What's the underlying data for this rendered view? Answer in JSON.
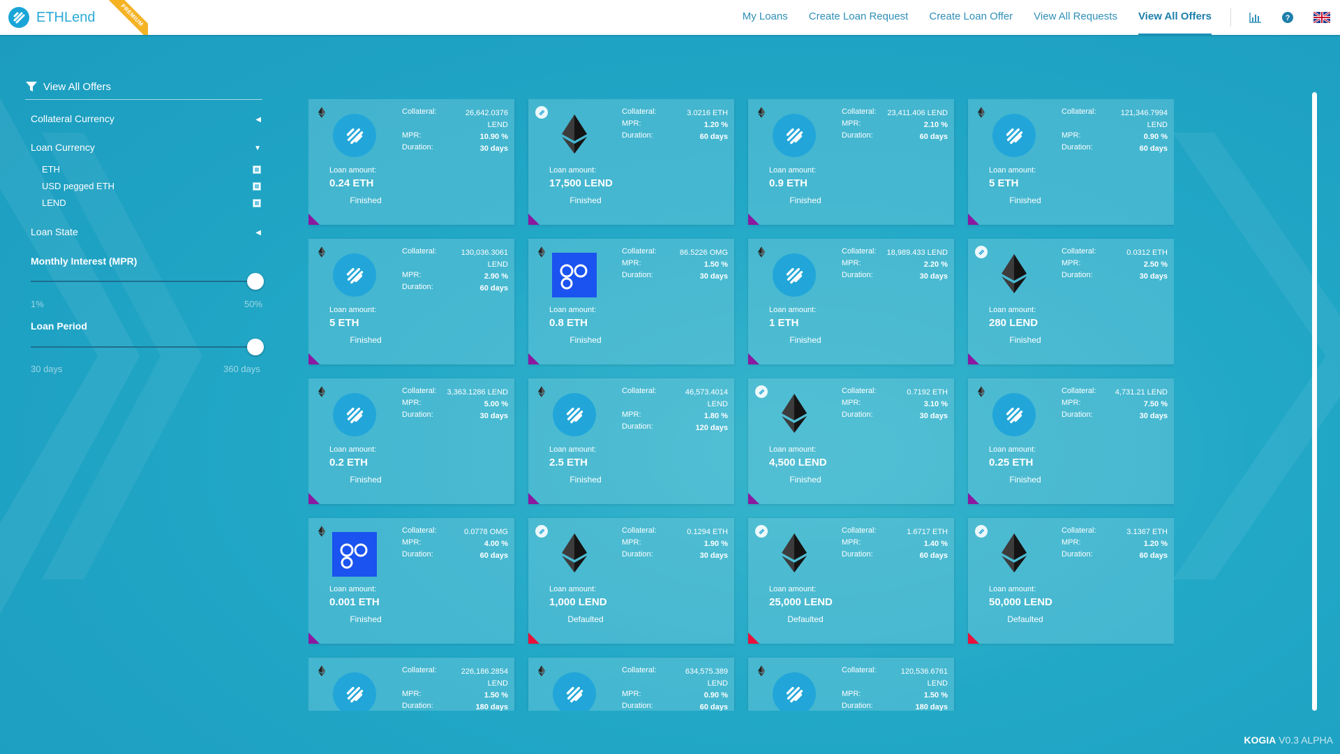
{
  "header": {
    "brand": "ETHLend",
    "badge": "PREMIUM",
    "nav": [
      {
        "label": "My Loans"
      },
      {
        "label": "Create Loan Request"
      },
      {
        "label": "Create Loan Offer"
      },
      {
        "label": "View All Requests"
      },
      {
        "label": "View All Offers",
        "active": true
      }
    ],
    "icons": [
      "bar-chart-icon",
      "help-icon",
      "uk-flag-icon"
    ]
  },
  "sidebar": {
    "title": "View All Offers",
    "collateral_currency": "Collateral Currency",
    "loan_currency": "Loan Currency",
    "currencies": [
      "ETH",
      "USD pegged ETH",
      "LEND"
    ],
    "loan_state": "Loan State",
    "mpr_title": "Monthly Interest (MPR)",
    "mpr_min": "1%",
    "mpr_max": "50%",
    "mpr_value_fraction": 1.0,
    "period_title": "Loan Period",
    "period_min": "30 days",
    "period_max": "360 days",
    "period_value_fraction": 1.0
  },
  "labels": {
    "collateral": "Collateral:",
    "mpr": "MPR:",
    "duration": "Duration:",
    "loan_amount": "Loan amount:"
  },
  "cards": [
    {
      "corner": "eth",
      "logo": "lend",
      "collateral": "26,642.0376\nLEND",
      "mpr": "10.90 %",
      "duration": "30 days",
      "amount": "0.24 ETH",
      "state": "Finished"
    },
    {
      "corner": "lend",
      "logo": "eth",
      "collateral": "3.0216 ETH",
      "mpr": "1.20 %",
      "duration": "60 days",
      "amount": "17,500 LEND",
      "state": "Finished"
    },
    {
      "corner": "eth",
      "logo": "lend",
      "collateral": "23,411.406 LEND",
      "mpr": "2.10 %",
      "duration": "60 days",
      "amount": "0.9 ETH",
      "state": "Finished"
    },
    {
      "corner": "eth",
      "logo": "lend",
      "collateral": "121,346.7994\nLEND",
      "mpr": "0.90 %",
      "duration": "60 days",
      "amount": "5 ETH",
      "state": "Finished"
    },
    {
      "corner": "eth",
      "logo": "lend",
      "collateral": "130,036.3061\nLEND",
      "mpr": "2.90 %",
      "duration": "60 days",
      "amount": "5 ETH",
      "state": "Finished"
    },
    {
      "corner": "eth",
      "logo": "omg",
      "collateral": "86.5226 OMG",
      "mpr": "1.50 %",
      "duration": "30 days",
      "amount": "0.8 ETH",
      "state": "Finished"
    },
    {
      "corner": "eth",
      "logo": "lend",
      "collateral": "18,989.433 LEND",
      "mpr": "2.20 %",
      "duration": "30 days",
      "amount": "1 ETH",
      "state": "Finished"
    },
    {
      "corner": "lend",
      "logo": "eth",
      "collateral": "0.0312 ETH",
      "mpr": "2.50 %",
      "duration": "30 days",
      "amount": "280 LEND",
      "state": "Finished"
    },
    {
      "corner": "eth",
      "logo": "lend",
      "collateral": "3,363.1286 LEND",
      "mpr": "5.00 %",
      "duration": "30 days",
      "amount": "0.2 ETH",
      "state": "Finished"
    },
    {
      "corner": "eth",
      "logo": "lend",
      "collateral": "46,573.4014\nLEND",
      "mpr": "1.80 %",
      "duration": "120 days",
      "amount": "2.5 ETH",
      "state": "Finished"
    },
    {
      "corner": "lend",
      "logo": "eth",
      "collateral": "0.7192 ETH",
      "mpr": "3.10 %",
      "duration": "30 days",
      "amount": "4,500 LEND",
      "state": "Finished"
    },
    {
      "corner": "eth",
      "logo": "lend",
      "collateral": "4,731.21 LEND",
      "mpr": "7.50 %",
      "duration": "30 days",
      "amount": "0.25 ETH",
      "state": "Finished"
    },
    {
      "corner": "eth",
      "logo": "omg",
      "collateral": "0.0778 OMG",
      "mpr": "4.00 %",
      "duration": "60 days",
      "amount": "0.001 ETH",
      "state": "Finished"
    },
    {
      "corner": "lend",
      "logo": "eth",
      "collateral": "0.1294 ETH",
      "mpr": "1.90 %",
      "duration": "30 days",
      "amount": "1,000 LEND",
      "state": "Defaulted"
    },
    {
      "corner": "lend",
      "logo": "eth",
      "collateral": "1.6717 ETH",
      "mpr": "1.40 %",
      "duration": "60 days",
      "amount": "25,000 LEND",
      "state": "Defaulted"
    },
    {
      "corner": "lend",
      "logo": "eth",
      "collateral": "3.1367 ETH",
      "mpr": "1.20 %",
      "duration": "60 days",
      "amount": "50,000 LEND",
      "state": "Defaulted"
    },
    {
      "corner": "eth",
      "logo": "lend",
      "collateral": "226,186.2854\nLEND",
      "mpr": "1.50 %",
      "duration": "180 days",
      "amount": "",
      "state": ""
    },
    {
      "corner": "eth",
      "logo": "lend",
      "collateral": "634,575.389\nLEND",
      "mpr": "0.90 %",
      "duration": "60 days",
      "amount": "",
      "state": ""
    },
    {
      "corner": "eth",
      "logo": "lend",
      "collateral": "120,536.6761\nLEND",
      "mpr": "1.50 %",
      "duration": "180 days",
      "amount": "",
      "state": ""
    }
  ],
  "footer": {
    "brand": "KOGIA",
    "version": "V0.3 ALPHA"
  },
  "colors": {
    "accent": "#1d8fbe",
    "finished": "#8a1aa0",
    "defaulted": "#e8113b"
  }
}
